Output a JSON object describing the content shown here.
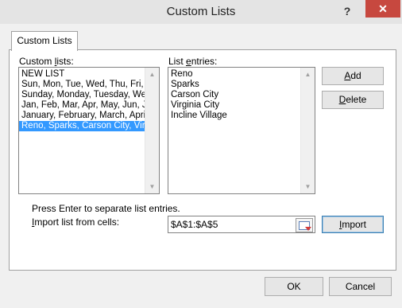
{
  "window": {
    "title": "Custom Lists",
    "help_label": "?",
    "close_label": "✕"
  },
  "tab": {
    "label": "Custom Lists"
  },
  "custom_lists": {
    "label_pre": "Custom ",
    "label_key": "l",
    "label_post": "ists:",
    "items": [
      "NEW LIST",
      "Sun, Mon, Tue, Wed, Thu, Fri, S",
      "Sunday, Monday, Tuesday, We",
      "Jan, Feb, Mar, Apr, May, Jun, Ju",
      "January, February, March, Apri",
      "Reno, Sparks, Carson City, Virc"
    ],
    "selected_index": 5
  },
  "list_entries": {
    "label_pre": "List ",
    "label_key": "e",
    "label_post": "ntries:",
    "items": [
      "Reno",
      "Sparks",
      "Carson City",
      "Virginia City",
      "Incline Village"
    ]
  },
  "buttons": {
    "add": {
      "key": "A",
      "rest": "dd"
    },
    "delete": {
      "key": "D",
      "rest": "elete"
    },
    "import": {
      "key": "I",
      "rest": "mport"
    },
    "ok": "OK",
    "cancel": "Cancel"
  },
  "hint": "Press Enter to separate list entries.",
  "import_from": {
    "label_key": "I",
    "label_rest": "mport list from cells:",
    "value": "$A$1:$A$5"
  },
  "icons": {
    "scroll_up": "scroll-up-arrow",
    "scroll_down": "scroll-down-arrow",
    "range_picker": "collapse-dialog-icon"
  },
  "colors": {
    "selection": "#3399ff",
    "close": "#c7483f"
  }
}
